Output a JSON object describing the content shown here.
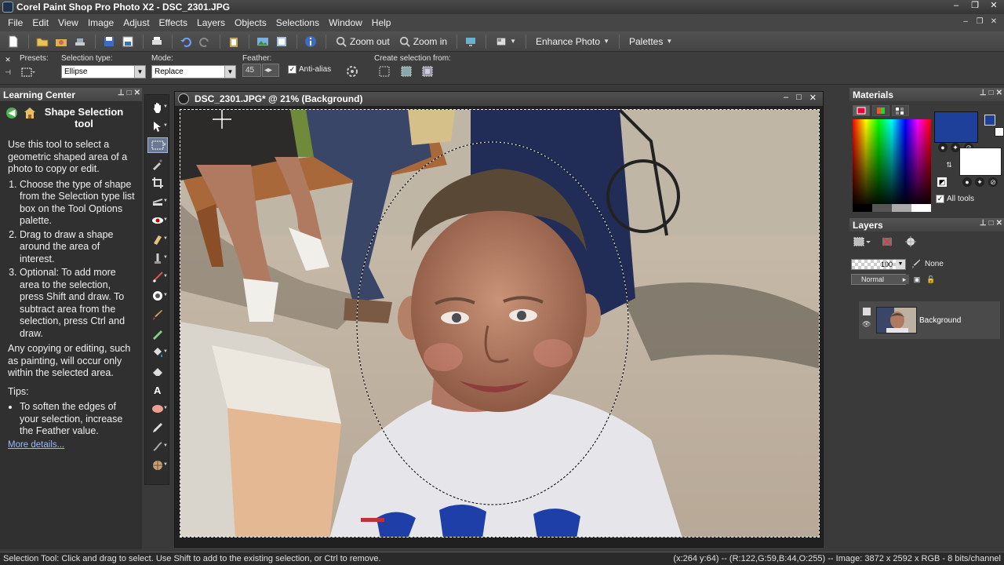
{
  "window": {
    "title": "Corel Paint Shop Pro Photo X2 - DSC_2301.JPG"
  },
  "menu": [
    "File",
    "Edit",
    "View",
    "Image",
    "Adjust",
    "Effects",
    "Layers",
    "Objects",
    "Selections",
    "Window",
    "Help"
  ],
  "toolbar": {
    "zoom_out": "Zoom out",
    "zoom_in": "Zoom in",
    "enhance_photo": "Enhance Photo",
    "palettes": "Palettes"
  },
  "tool_options": {
    "presets_label": "Presets:",
    "selection_type_label": "Selection type:",
    "selection_type_value": "Ellipse",
    "mode_label": "Mode:",
    "mode_value": "Replace",
    "feather_label": "Feather:",
    "feather_value": "45",
    "antialias_label": "Anti-alias",
    "antialias_checked": true,
    "create_from_label": "Create selection from:"
  },
  "learning_center": {
    "header": "Learning Center",
    "title": "Shape Selection tool",
    "intro": "Use this tool to select a geometric shaped area of a photo to copy or edit.",
    "steps": [
      "Choose the type of shape from the Selection type list box on the Tool Options palette.",
      "Drag to draw a shape around the area of interest.",
      "Optional: To add more area to the selection, press Shift and draw. To subtract area from the selection, press Ctrl and draw."
    ],
    "note": "Any copying or editing, such as painting, will occur only within the selected area.",
    "tips_label": "Tips:",
    "tips": [
      "To soften the edges of your selection, increase the Feather value."
    ],
    "more_link": "More details..."
  },
  "document": {
    "title": "DSC_2301.JPG* @ 21% (Background)"
  },
  "materials": {
    "header": "Materials",
    "foreground_color": "#1e3f9a",
    "background_color": "#ffffff",
    "all_tools_label": "All tools",
    "all_tools_checked": true
  },
  "layers": {
    "header": "Layers",
    "opacity": "100",
    "mask_label": "None",
    "blend_mode": "Normal",
    "items": [
      {
        "name": "Background"
      }
    ]
  },
  "status": {
    "hint": "Selection Tool: Click and drag to select. Use Shift to add to the existing selection, or Ctrl to remove.",
    "info": "(x:264 y:64) -- (R:122,G:59,B:44,O:255) -- Image:  3872 x 2592 x RGB - 8 bits/channel"
  }
}
